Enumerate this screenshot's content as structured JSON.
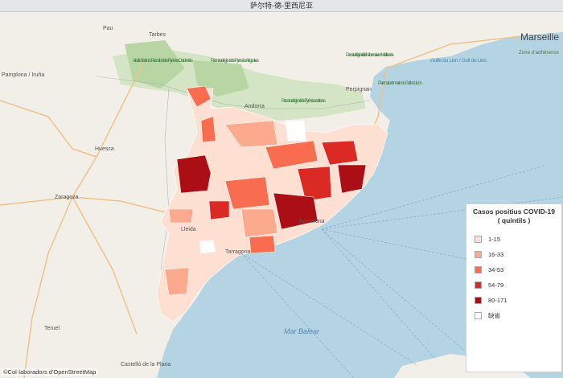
{
  "title": "萨尔特-德-里西尼亚",
  "attribution": "©Col·laboradors d'OpenStreetMap",
  "legend": {
    "title": "Casos positius COVID-19 ( quintils )",
    "items": [
      {
        "label": "1-15",
        "color": "#fde0d2"
      },
      {
        "label": "16-33",
        "color": "#fcaa8e"
      },
      {
        "label": "34-53",
        "color": "#f86d4f"
      },
      {
        "label": "54-79",
        "color": "#db2a24"
      },
      {
        "label": "80-171",
        "color": "#ab0e15"
      },
      {
        "label": "缺省",
        "color": "#ffffff"
      }
    ]
  },
  "places": {
    "marseille": "Marseille",
    "andorra": "Andorra",
    "zaragoza": "Zaragoza",
    "huesca": "Huesca",
    "perpignan": "Perpignan",
    "pamplona": "Pamplona / Iruña",
    "pau": "Pau",
    "tarbes": "Tarbes",
    "barcelona": "Barcelona",
    "tarragona": "Tarragona",
    "teruel": "Teruel",
    "castellon": "Castelló de la Plana",
    "lleida": "Lleida"
  },
  "parks": {
    "pyrenees_occidentales": "Aire d'adhésion du Parc national des Pyrénées Occidentales",
    "pyrenees_ariegeoises": "Parc naturel régional des Pyrénées Ariégeoises",
    "pyrenees_catalanes": "Parc naturel régional des Pyrénées catalanes",
    "narbonnaise": "Parc naturel régional de la Narbonnaise en Méditerranée",
    "golfe_lion_marin": "Parc naturel marin du Golfe du Lion",
    "adherence": "Zone d'adhérence"
  },
  "seas": {
    "mar_balear": "Mar Balear",
    "golfe_du_lion": "Golfe du Lion / Golf de Lleó"
  }
}
